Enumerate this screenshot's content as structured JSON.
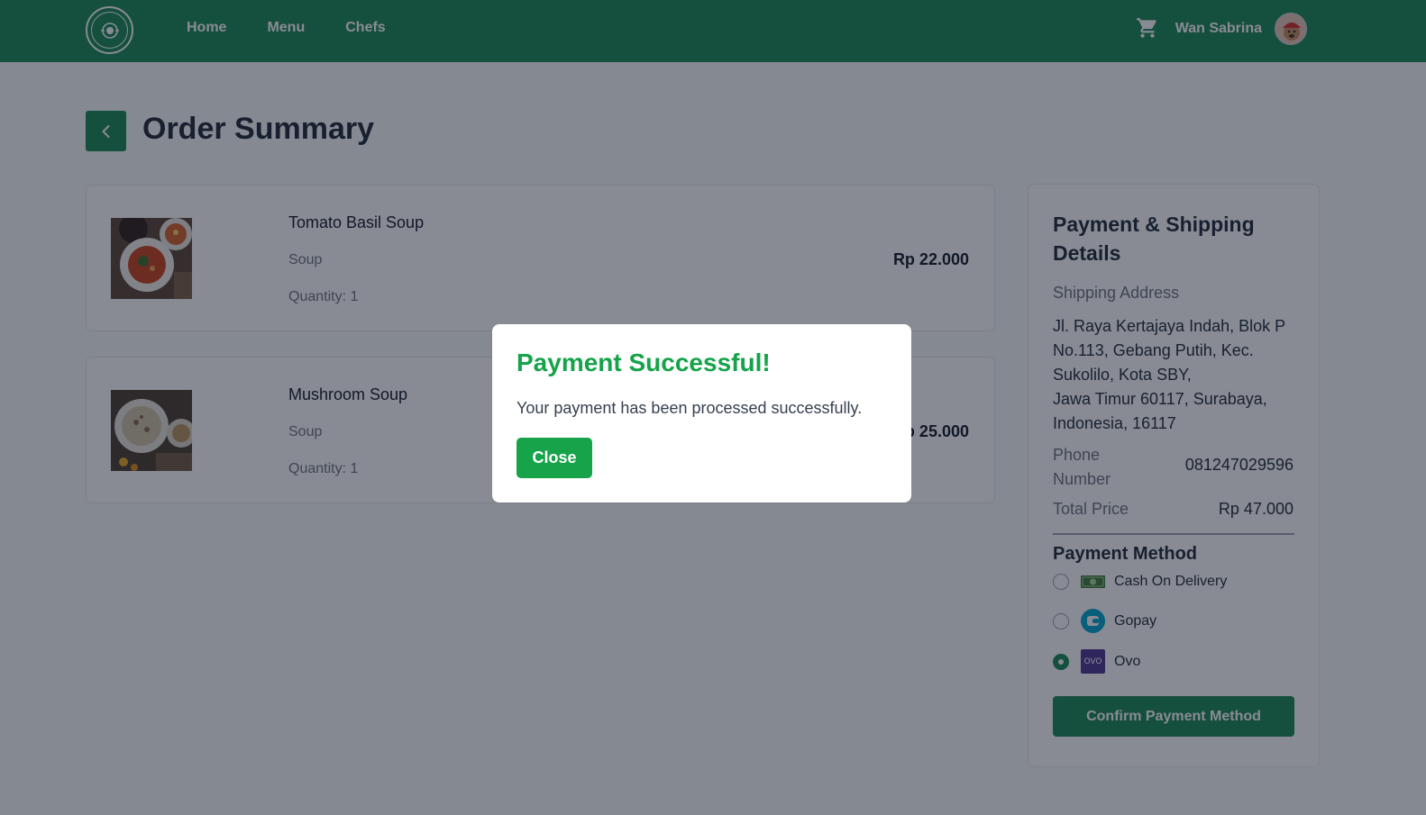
{
  "nav": {
    "links": [
      "Home",
      "Menu",
      "Chefs"
    ],
    "user_name": "Wan Sabrina"
  },
  "page": {
    "title": "Order Summary"
  },
  "items": [
    {
      "name": "Tomato Basil Soup",
      "category": "Soup",
      "quantity": "Quantity: 1",
      "price": "Rp 22.000"
    },
    {
      "name": "Mushroom Soup",
      "category": "Soup",
      "quantity": "Quantity: 1",
      "price": "Rp 25.000"
    }
  ],
  "sidebar": {
    "title": "Payment & Shipping Details",
    "shipping_label": "Shipping Address",
    "address_lines": [
      "Jl. Raya Kertajaya Indah, Blok P No.113, Gebang Putih, Kec. Sukolilo, Kota SBY,",
      "Jawa Timur 60117, Surabaya, Indonesia, 16117"
    ],
    "phone_label": "Phone Number",
    "phone_value": "081247029596",
    "total_label": "Total Price",
    "total_value": "Rp 47.000",
    "payment_method_title": "Payment Method",
    "payment_methods": [
      {
        "label": "Cash On Delivery",
        "icon": "cash-icon",
        "selected": false
      },
      {
        "label": "Gopay",
        "icon": "gopay-icon",
        "selected": false
      },
      {
        "label": "Ovo",
        "icon": "ovo-icon",
        "icon_text": "OVO",
        "selected": true
      }
    ],
    "confirm_label": "Confirm Payment Method"
  },
  "modal": {
    "title": "Payment Successful!",
    "message": "Your payment has been processed successfully.",
    "close_label": "Close"
  },
  "colors": {
    "brand_green": "#198754",
    "success_green": "#16a34a"
  }
}
